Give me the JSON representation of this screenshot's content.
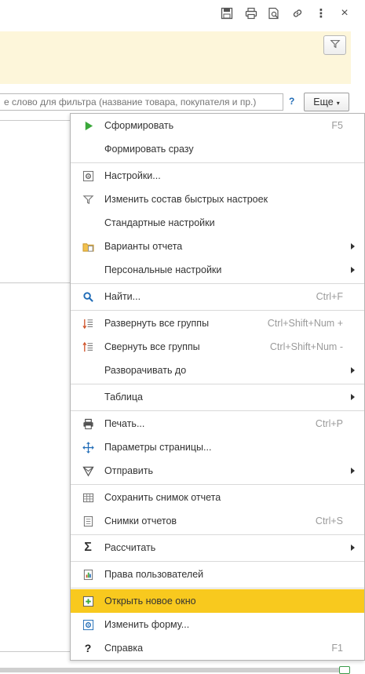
{
  "toolbar": {
    "icons": [
      "save-icon",
      "print-icon",
      "preview-icon",
      "link-icon",
      "more-vertical-icon",
      "close-icon"
    ],
    "close_glyph": "×",
    "more_glyph": "⋮"
  },
  "filter": {
    "placeholder": "е слово для фильтра (название товара, покупателя и пр.)",
    "help": "?",
    "more_label": "Еще",
    "more_caret": "▾"
  },
  "colors": {
    "highlight": "#f8c91e",
    "panel": "#fdf6da",
    "accent_green": "#3aa83a"
  },
  "menu": {
    "items": [
      {
        "label": "Сформировать",
        "shortcut": "F5",
        "icon": "play-icon"
      },
      {
        "label": "Формировать сразу",
        "shortcut": "",
        "icon": ""
      },
      {
        "label": "Настройки...",
        "shortcut": "",
        "icon": "settings-icon"
      },
      {
        "label": "Изменить состав быстрых настроек",
        "shortcut": "",
        "icon": "filter-icon"
      },
      {
        "label": "Стандартные настройки",
        "shortcut": "",
        "icon": ""
      },
      {
        "label": "Варианты отчета",
        "shortcut": "",
        "icon": "folder-icon",
        "submenu": true
      },
      {
        "label": "Персональные настройки",
        "shortcut": "",
        "icon": "",
        "submenu": true
      },
      {
        "label": "Найти...",
        "shortcut": "Ctrl+F",
        "icon": "search-icon"
      },
      {
        "label": "Развернуть все группы",
        "shortcut": "Ctrl+Shift+Num +",
        "icon": "expand-groups-icon"
      },
      {
        "label": "Свернуть все группы",
        "shortcut": "Ctrl+Shift+Num -",
        "icon": "collapse-groups-icon"
      },
      {
        "label": "Разворачивать до",
        "shortcut": "",
        "icon": "",
        "submenu": true
      },
      {
        "label": "Таблица",
        "shortcut": "",
        "icon": "",
        "submenu": true
      },
      {
        "label": "Печать...",
        "shortcut": "Ctrl+P",
        "icon": "print-icon"
      },
      {
        "label": "Параметры страницы...",
        "shortcut": "",
        "icon": "page-setup-icon"
      },
      {
        "label": "Отправить",
        "shortcut": "",
        "icon": "send-icon",
        "submenu": true
      },
      {
        "label": "Сохранить снимок отчета",
        "shortcut": "",
        "icon": "snapshot-save-icon"
      },
      {
        "label": "Снимки отчетов",
        "shortcut": "Ctrl+S",
        "icon": "snapshots-icon"
      },
      {
        "label": "Рассчитать",
        "shortcut": "",
        "icon": "sigma-icon",
        "submenu": true
      },
      {
        "label": "Права пользователей",
        "shortcut": "",
        "icon": "user-rights-icon"
      },
      {
        "label": "Открыть новое окно",
        "shortcut": "",
        "icon": "new-window-icon",
        "highlighted": true
      },
      {
        "label": "Изменить форму...",
        "shortcut": "",
        "icon": "change-form-icon"
      },
      {
        "label": "Справка",
        "shortcut": "F1",
        "icon": "help-icon"
      }
    ]
  }
}
